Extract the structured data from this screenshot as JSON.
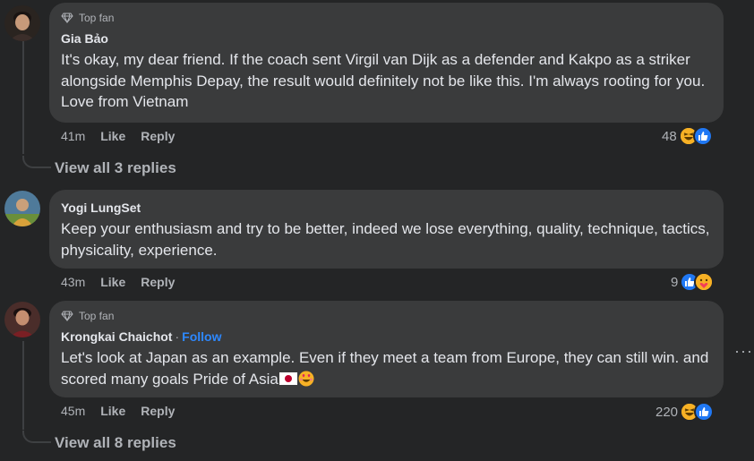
{
  "comments": [
    {
      "author": "Gia Bảo",
      "badge": "Top fan",
      "text": "It's okay, my dear friend. If the coach sent Virgil van Dijk as a defender and Kakpo as a striker alongside Memphis Depay, the result would definitely not be like this. I'm always rooting for you. Love from Vietnam",
      "time": "41m",
      "like_label": "Like",
      "reply_label": "Reply",
      "reaction_count": "48",
      "reactions": [
        "haha-icon",
        "like-icon"
      ]
    },
    {
      "author": "Yogi LungSet",
      "text": "Keep your enthusiasm and try to be better, indeed we lose everything, quality, technique, tactics, physicality, experience.",
      "time": "43m",
      "like_label": "Like",
      "reply_label": "Reply",
      "reaction_count": "9",
      "reactions": [
        "like-icon",
        "care-icon"
      ]
    },
    {
      "author": "Krongkai Chaichot",
      "badge": "Top fan",
      "separator": "·",
      "follow_label": "Follow",
      "text": "Let's look at Japan as an example. Even if they meet a team from Europe, they can still win. and scored many goals Pride of Asia",
      "time": "45m",
      "like_label": "Like",
      "reply_label": "Reply",
      "reaction_count": "220",
      "reactions": [
        "haha-icon",
        "like-icon"
      ]
    }
  ],
  "view_replies_1": "View all 3 replies",
  "view_replies_3": "View all 8 replies",
  "more_icon": "···",
  "colors": {
    "background": "#242526",
    "bubble": "#3a3b3c",
    "follow": "#2d88ff",
    "like": "#2078f4",
    "haha": "#f7b125"
  }
}
